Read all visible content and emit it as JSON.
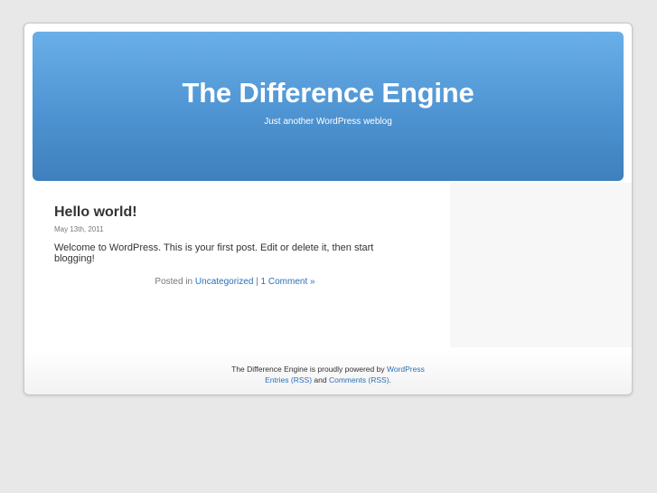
{
  "header": {
    "title": "The Difference Engine",
    "description": "Just another WordPress weblog"
  },
  "post": {
    "title": "Hello world!",
    "date": "May 13th, 2011",
    "body": "Welcome to WordPress. This is your first post. Edit or delete it, then start blogging!",
    "meta_prefix": "Posted in ",
    "category": "Uncategorized",
    "separator": " | ",
    "comments": "1 Comment »"
  },
  "footer": {
    "powered_text": "The Difference Engine is proudly powered by ",
    "powered_link": "WordPress",
    "entries_link": "Entries (RSS)",
    "and_text": " and ",
    "comments_link": "Comments (RSS)",
    "end_text": "."
  },
  "colors": {
    "header_gradient_top": "#6aafe8",
    "header_gradient_bottom": "#3f7fbd",
    "link": "#2a70b8",
    "background": "#e8e8e8"
  }
}
